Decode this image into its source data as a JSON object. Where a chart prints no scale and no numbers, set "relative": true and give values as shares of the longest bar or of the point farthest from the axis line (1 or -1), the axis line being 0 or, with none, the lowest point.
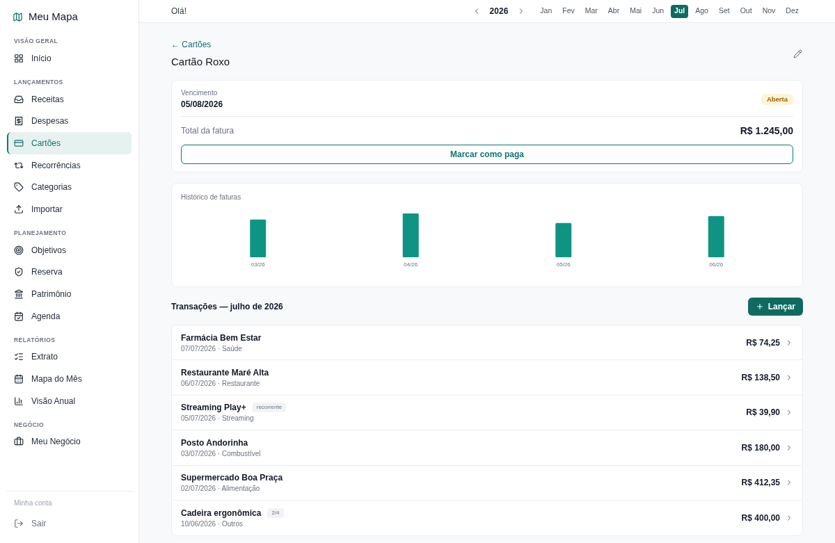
{
  "sidebar": {
    "brand": "Meu Mapa",
    "sections": [
      {
        "title": "VISÃO GERAL",
        "items": [
          {
            "label": "Início",
            "selected": false
          }
        ]
      },
      {
        "title": "LANÇAMENTOS",
        "items": [
          {
            "label": "Receitas",
            "selected": false
          },
          {
            "label": "Despesas",
            "selected": false
          },
          {
            "label": "Cartões",
            "selected": true
          },
          {
            "label": "Recorrências",
            "selected": false
          },
          {
            "label": "Categorias",
            "selected": false
          },
          {
            "label": "Importar",
            "selected": false
          }
        ]
      },
      {
        "title": "PLANEJAMENTO",
        "items": [
          {
            "label": "Objetivos",
            "selected": false
          },
          {
            "label": "Reserva",
            "selected": false
          },
          {
            "label": "Patrimônio",
            "selected": false
          },
          {
            "label": "Agenda",
            "selected": false
          }
        ]
      },
      {
        "title": "RELATÓRIOS",
        "items": [
          {
            "label": "Extrato",
            "selected": false
          },
          {
            "label": "Mapa do Mês",
            "selected": false
          },
          {
            "label": "Visão Anual",
            "selected": false
          }
        ]
      },
      {
        "title": "NEGÓCIO",
        "items": [
          {
            "label": "Meu Negócio",
            "selected": false
          }
        ]
      }
    ],
    "footer": {
      "title": "Minha conta",
      "logout": "Sair"
    }
  },
  "topbar": {
    "greeting": "Olá!",
    "year": "2026",
    "months": [
      {
        "label": "Jan",
        "selected": false
      },
      {
        "label": "Fev",
        "selected": false
      },
      {
        "label": "Mar",
        "selected": false
      },
      {
        "label": "Abr",
        "selected": false
      },
      {
        "label": "Mai",
        "selected": false
      },
      {
        "label": "Jun",
        "selected": false
      },
      {
        "label": "Jul",
        "selected": true
      },
      {
        "label": "Ago",
        "selected": false
      },
      {
        "label": "Set",
        "selected": false
      },
      {
        "label": "Out",
        "selected": false
      },
      {
        "label": "Nov",
        "selected": false
      },
      {
        "label": "Dez",
        "selected": false
      }
    ]
  },
  "page": {
    "back_link": "← Cartões",
    "title": "Cartão Roxo"
  },
  "invoice": {
    "due_label": "Vencimento",
    "due_date": "05/08/2026",
    "status": {
      "label": "Aberta",
      "kind": "open"
    },
    "total_label": "Total da fatura",
    "total": "R$ 1.245,00",
    "action": "Marcar como paga"
  },
  "history": {
    "chart_data": {
      "type": "bar",
      "title": "Histórico de faturas",
      "relative": true,
      "categories": [
        "03/26",
        "04/26",
        "05/26",
        "06/26"
      ],
      "values": [
        0.86,
        1.0,
        0.78,
        0.94
      ]
    }
  },
  "transactions": {
    "title": "Transações — julho de 2026",
    "add_button": "Lançar",
    "rows": [
      {
        "name": "Farmácia Bem Estar",
        "detail": "07/07/2026 · Saúde",
        "amount": "R$ 74,25"
      },
      {
        "name": "Restaurante Maré Alta",
        "detail": "06/07/2026 · Restaurante",
        "amount": "R$ 138,50"
      },
      {
        "name": "Streaming Play+",
        "tag": "recorrente",
        "detail": "05/07/2026 · Streaming",
        "amount": "R$ 39,90"
      },
      {
        "name": "Posto Andorinha",
        "detail": "03/07/2026 · Combustível",
        "amount": "R$ 180,00"
      },
      {
        "name": "Supermercado Boa Praça",
        "detail": "02/07/2026 · Alimentação",
        "amount": "R$ 412,35"
      },
      {
        "name": "Cadeira ergonômica",
        "tag": "2/4",
        "detail": "10/06/2026 · Outros",
        "amount": "R$ 400,00"
      }
    ]
  }
}
